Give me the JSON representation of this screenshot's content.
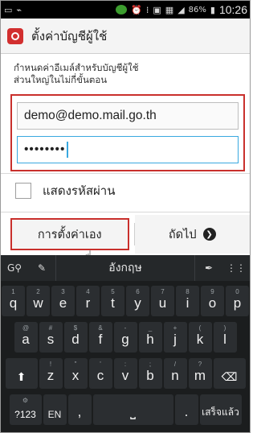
{
  "status_bar": {
    "battery_pct": "86%",
    "time": "10:26",
    "icons": [
      "screenshot-icon",
      "usb-icon",
      "app-notification-icon",
      "alarm-icon",
      "vibrate-icon",
      "nfc-icon",
      "gallery-icon",
      "signal-icon",
      "battery-icon"
    ]
  },
  "header": {
    "title": "ตั้งค่าบัญชีผู้ใช้"
  },
  "description": {
    "line1": "กำหนดค่าอีเมล์สำหรับบัญชีผู้ใช้",
    "line2": "ส่วนใหญ่ในไม่กี่ขั้นตอน"
  },
  "form": {
    "email_value": "demo@demo.mail.go.th",
    "password_masked": "••••••••",
    "show_password_label": "แสดงรหัสผ่าน"
  },
  "buttons": {
    "manual_setup": "การตั้งค่าเอง",
    "next": "ถัดไป"
  },
  "keyboard": {
    "language": "อังกฤษ",
    "row1": [
      {
        "k": "q",
        "s": "1"
      },
      {
        "k": "w",
        "s": "2"
      },
      {
        "k": "e",
        "s": "3"
      },
      {
        "k": "r",
        "s": "4"
      },
      {
        "k": "t",
        "s": "5"
      },
      {
        "k": "y",
        "s": "6"
      },
      {
        "k": "u",
        "s": "7"
      },
      {
        "k": "i",
        "s": "8"
      },
      {
        "k": "o",
        "s": "9"
      },
      {
        "k": "p",
        "s": "0"
      }
    ],
    "row2": [
      {
        "k": "a",
        "s": "@"
      },
      {
        "k": "s",
        "s": "#"
      },
      {
        "k": "d",
        "s": "$"
      },
      {
        "k": "f",
        "s": "&"
      },
      {
        "k": "g",
        "s": "-"
      },
      {
        "k": "h",
        "s": "_"
      },
      {
        "k": "j",
        "s": "+"
      },
      {
        "k": "k",
        "s": "("
      },
      {
        "k": "l",
        "s": ")"
      }
    ],
    "row3": [
      {
        "k": "z",
        "s": "!"
      },
      {
        "k": "x",
        "s": "\""
      },
      {
        "k": "c",
        "s": "'"
      },
      {
        "k": "v",
        "s": ":"
      },
      {
        "k": "b",
        "s": ";"
      },
      {
        "k": "n",
        "s": "/"
      },
      {
        "k": "m",
        "s": "?"
      }
    ],
    "sym_label": "?123",
    "lang_label": "EN",
    "comma": ",",
    "period": ".",
    "done_label": "เสร็จแล้ว"
  }
}
